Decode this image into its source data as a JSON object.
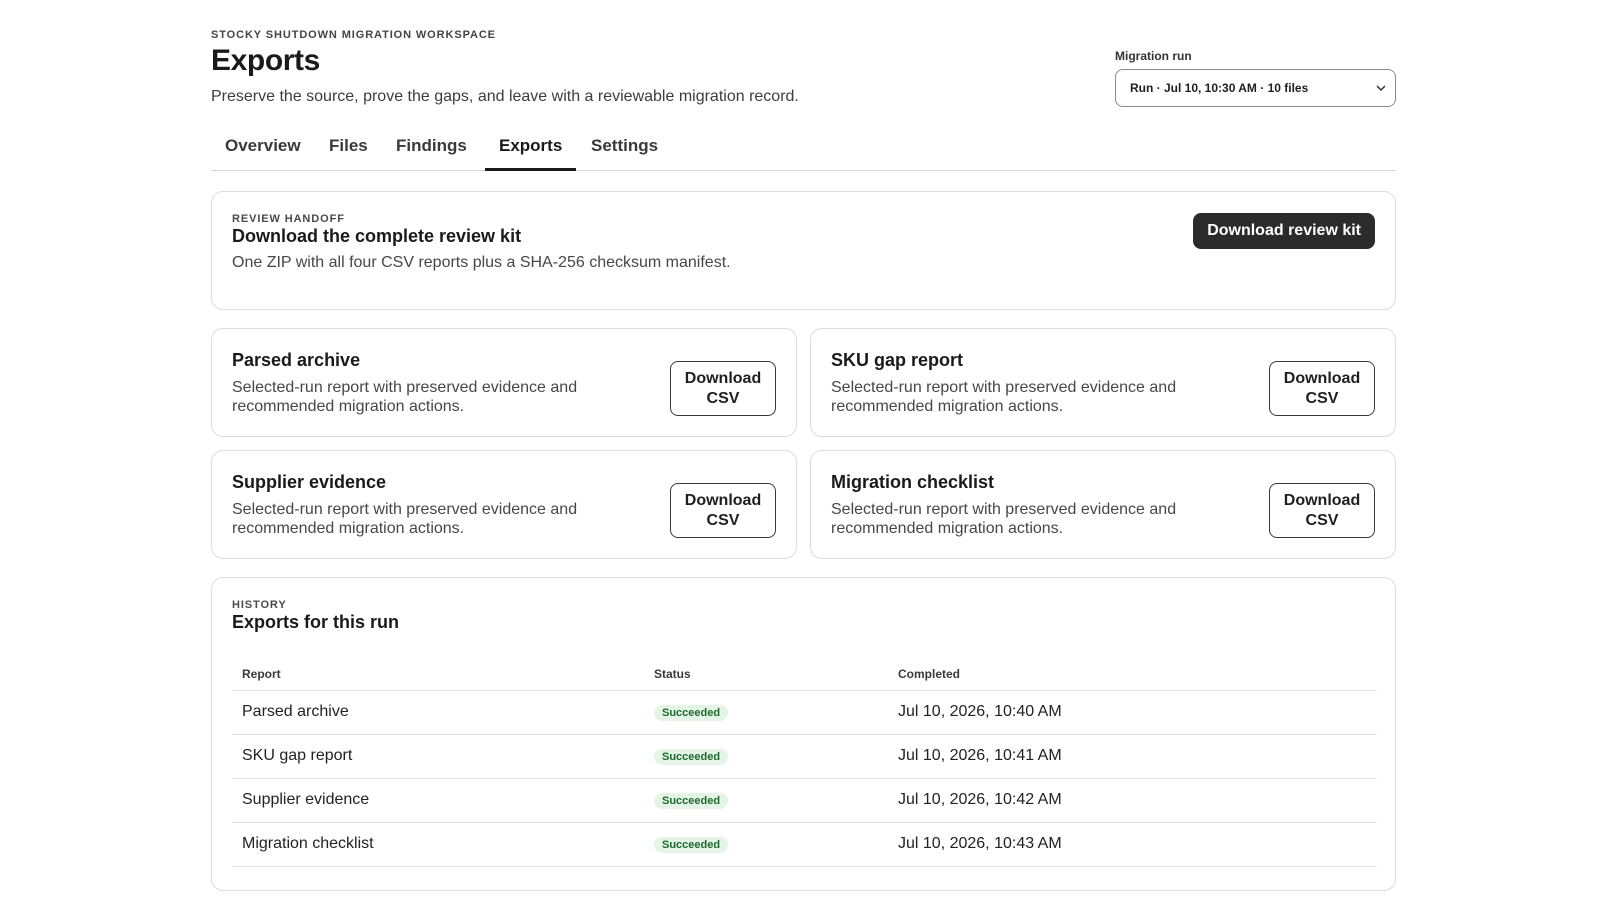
{
  "header": {
    "eyebrow": "STOCKY SHUTDOWN MIGRATION WORKSPACE",
    "title": "Exports",
    "subtitle": "Preserve the source, prove the gaps, and leave with a reviewable migration record."
  },
  "run_selector": {
    "label": "Migration run",
    "value": "Run · Jul 10, 10:30 AM · 10 files"
  },
  "tabs": [
    {
      "label": "Overview",
      "active": false
    },
    {
      "label": "Files",
      "active": false
    },
    {
      "label": "Findings",
      "active": false
    },
    {
      "label": "Exports",
      "active": true
    },
    {
      "label": "Settings",
      "active": false
    }
  ],
  "review_kit": {
    "eyebrow": "REVIEW HANDOFF",
    "title": "Download the complete review kit",
    "description": "One ZIP with all four CSV reports plus a SHA-256 checksum manifest.",
    "button_label": "Download review kit"
  },
  "reports": [
    {
      "title": "Parsed archive",
      "description": "Selected-run report with preserved evidence and recommended migration actions.",
      "button_label": "Download\nCSV"
    },
    {
      "title": "SKU gap report",
      "description": "Selected-run report with preserved evidence and recommended migration actions.",
      "button_label": "Download\nCSV"
    },
    {
      "title": "Supplier evidence",
      "description": "Selected-run report with preserved evidence and recommended migration actions.",
      "button_label": "Download\nCSV"
    },
    {
      "title": "Migration checklist",
      "description": "Selected-run report with preserved evidence and recommended migration actions.",
      "button_label": "Download\nCSV"
    }
  ],
  "history": {
    "eyebrow": "HISTORY",
    "title": "Exports for this run",
    "columns": [
      "Report",
      "Status",
      "Completed"
    ],
    "rows": [
      {
        "report": "Parsed archive",
        "status": "Succeeded",
        "completed": "Jul 10, 2026, 10:40 AM"
      },
      {
        "report": "SKU gap report",
        "status": "Succeeded",
        "completed": "Jul 10, 2026, 10:41 AM"
      },
      {
        "report": "Supplier evidence",
        "status": "Succeeded",
        "completed": "Jul 10, 2026, 10:42 AM"
      },
      {
        "report": "Migration checklist",
        "status": "Succeeded",
        "completed": "Jul 10, 2026, 10:43 AM"
      }
    ]
  },
  "colors": {
    "primary_button": "#2b2b2b",
    "success_badge_bg": "#e4f4e6",
    "success_badge_text": "#1d6a2c",
    "border": "#dcdcdc"
  },
  "icons": {
    "run_select_chevron": "chevron-down-icon"
  }
}
